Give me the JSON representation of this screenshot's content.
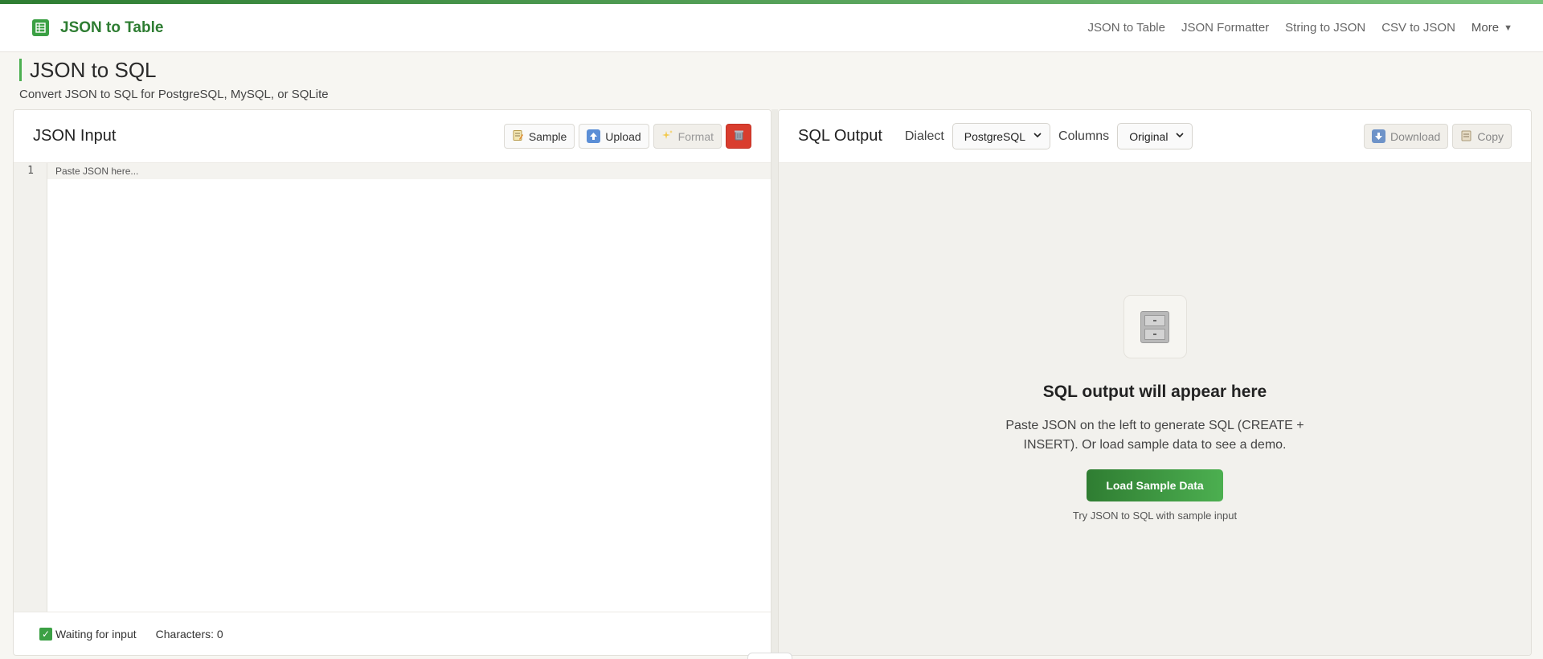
{
  "nav": {
    "brand": "JSON to Table",
    "links": [
      "JSON to Table",
      "JSON Formatter",
      "String to JSON",
      "CSV to JSON"
    ],
    "more": "More",
    "more_caret": "▼"
  },
  "page": {
    "title": "JSON to SQL",
    "subtitle": "Convert JSON to SQL for PostgreSQL, MySQL, or SQLite"
  },
  "input_panel": {
    "title": "JSON Input",
    "buttons": {
      "sample": "Sample",
      "upload": "Upload",
      "format": "Format"
    },
    "line_number": "1",
    "placeholder": "Paste JSON here...",
    "status": "Waiting for input",
    "characters": "Characters: 0"
  },
  "output_panel": {
    "title": "SQL Output",
    "dialect_label": "Dialect",
    "dialect_value": "PostgreSQL",
    "columns_label": "Columns",
    "columns_value": "Original",
    "download": "Download",
    "copy": "Copy",
    "empty_title": "SQL output will appear here",
    "empty_desc": "Paste JSON on the left to generate SQL (CREATE + INSERT). Or load sample data to see a demo.",
    "load_button": "Load Sample Data",
    "hint": "Try JSON to SQL with sample input"
  },
  "colors": {
    "brand_green": "#2e7d32",
    "accent_green": "#4caf50",
    "danger_red": "#d93d2e"
  },
  "icons": {
    "brand": "table-icon",
    "sample": "memo-icon",
    "upload": "upload-arrow-icon",
    "format": "sparkles-icon",
    "clear": "trash-icon",
    "status": "check-icon",
    "download": "download-arrow-icon",
    "copy": "clipboard-icon",
    "empty": "file-cabinet-icon"
  }
}
